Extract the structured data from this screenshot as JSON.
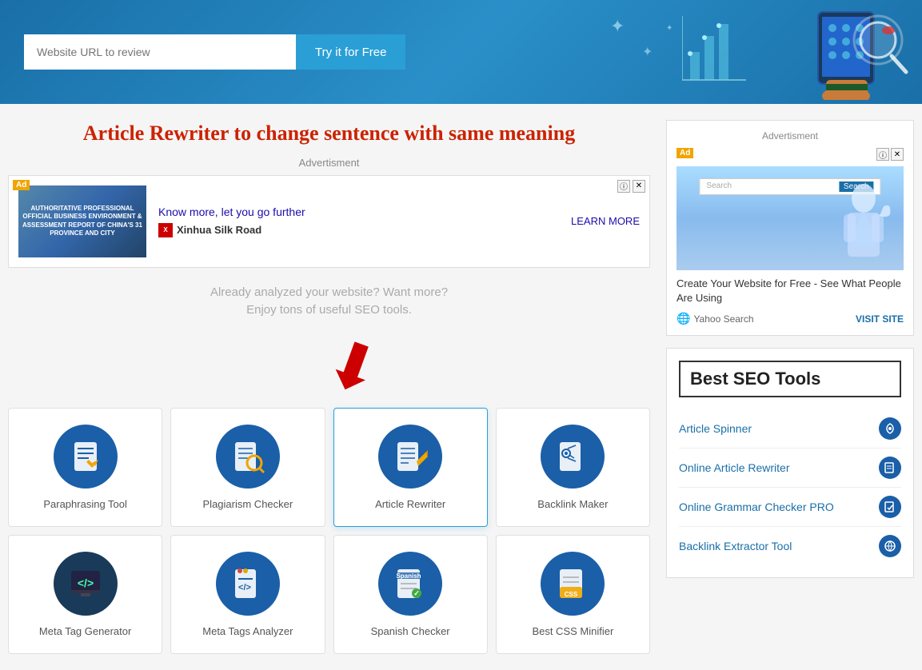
{
  "header": {
    "url_placeholder": "Website URL to review",
    "try_btn": "Try it for Free"
  },
  "page": {
    "title": "Article Rewriter to change sentence with same meaning"
  },
  "ad_main": {
    "label": "Advertisment",
    "link_text": "Know more, let you go further",
    "company": "Xinhua Silk Road",
    "learn_more": "LEARN MORE",
    "image_text": "AUTHORITATIVE PROFESSIONAL OFFICIAL\nBUSINESS ENVIRONMENT & ASSESSMENT REPORT OF CHINA'S 31 PROVINCE AND CITY"
  },
  "promo": {
    "line1": "Already analyzed your website? Want more?",
    "line2": "Enjoy tons of useful SEO tools."
  },
  "tools": [
    {
      "name": "Paraphrasing Tool",
      "icon_type": "paraphrase",
      "highlighted": false
    },
    {
      "name": "Plagiarism Checker",
      "icon_type": "plagiarism",
      "highlighted": false
    },
    {
      "name": "Article Rewriter",
      "icon_type": "rewriter",
      "highlighted": true
    },
    {
      "name": "Backlink Maker",
      "icon_type": "backlink",
      "highlighted": false
    },
    {
      "name": "Meta Tag Generator",
      "icon_type": "metatag",
      "highlighted": false
    },
    {
      "name": "Meta Tags Analyzer",
      "icon_type": "metatags",
      "highlighted": false
    },
    {
      "name": "Spanish Checker",
      "icon_type": "spanish",
      "highlighted": false
    },
    {
      "name": "Best CSS Minifier",
      "icon_type": "css",
      "highlighted": false
    }
  ],
  "sidebar": {
    "ad_label": "Advertisment",
    "ad_caption": "Create Your Website for Free - See What People Are Using",
    "ad_source": "Yahoo Search",
    "ad_visit": "VISIT SITE",
    "seo_title": "Best SEO Tools",
    "seo_items": [
      {
        "name": "Article Spinner",
        "icon": "🔄"
      },
      {
        "name": "Online Article Rewriter",
        "icon": "📝"
      },
      {
        "name": "Online Grammar Checker PRO",
        "icon": "✅"
      },
      {
        "name": "Backlink Extractor Tool",
        "icon": "🌐"
      }
    ]
  }
}
